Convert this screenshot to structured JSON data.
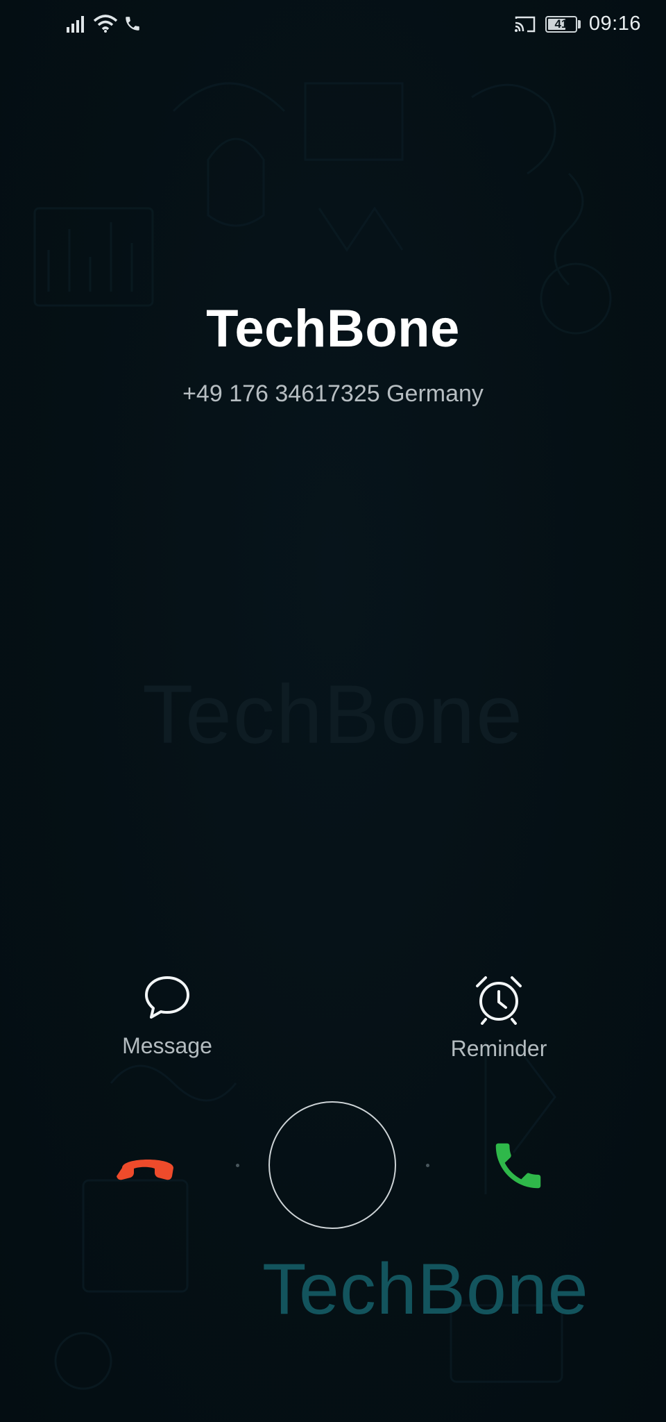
{
  "status_bar": {
    "time": "09:16",
    "battery_level": "41",
    "icons": [
      "signal-icon",
      "wifi-icon",
      "call-active-icon",
      "cast-icon",
      "battery-icon"
    ]
  },
  "caller": {
    "name": "TechBone",
    "number": "+49 176 34617325 Germany"
  },
  "center_watermark": "TechBone",
  "actions": {
    "message": {
      "label": "Message",
      "icon": "message-bubble-icon"
    },
    "reminder": {
      "label": "Reminder",
      "icon": "alarm-clock-icon"
    }
  },
  "call_controls": {
    "decline_icon": "decline-call-icon",
    "accept_icon": "accept-call-icon",
    "decline_color": "#ee4b2b",
    "accept_color": "#2fb84a"
  },
  "brand_watermark": "TechBone"
}
